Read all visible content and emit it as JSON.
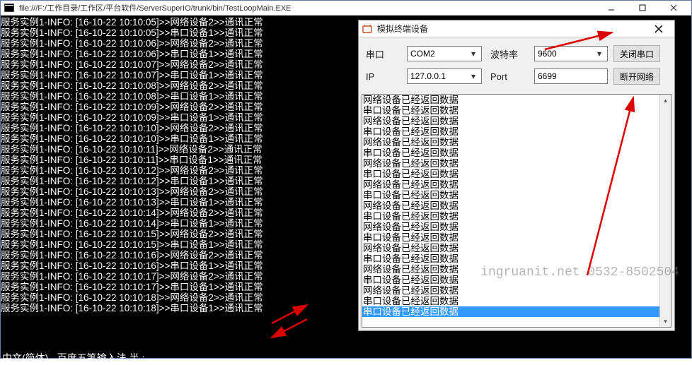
{
  "main_window": {
    "title": "file:///F:/工作目录/工作区/平台软件/ServerSuperIO/trunk/bin/TestLoopMain.EXE"
  },
  "console_lines": [
    "服务实例1-INFO: [16-10-22 10:10:05]>>网络设备2>>通讯正常",
    "服务实例1-INFO: [16-10-22 10:10:05]>>串口设备1>>通讯正常",
    "服务实例1-INFO: [16-10-22 10:10:06]>>网络设备2>>通讯正常",
    "服务实例1-INFO: [16-10-22 10:10:06]>>串口设备1>>通讯正常",
    "服务实例1-INFO: [16-10-22 10:10:07]>>网络设备2>>通讯正常",
    "服务实例1-INFO: [16-10-22 10:10:07]>>串口设备1>>通讯正常",
    "服务实例1-INFO: [16-10-22 10:10:08]>>网络设备2>>通讯正常",
    "服务实例1-INFO: [16-10-22 10:10:08]>>串口设备1>>通讯正常",
    "服务实例1-INFO: [16-10-22 10:10:09]>>网络设备2>>通讯正常",
    "服务实例1-INFO: [16-10-22 10:10:09]>>串口设备1>>通讯正常",
    "服务实例1-INFO: [16-10-22 10:10:10]>>网络设备2>>通讯正常",
    "服务实例1-INFO: [16-10-22 10:10:10]>>串口设备1>>通讯正常",
    "服务实例1-INFO: [16-10-22 10:10:11]>>网络设备2>>通讯正常",
    "服务实例1-INFO: [16-10-22 10:10:11]>>串口设备1>>通讯正常",
    "服务实例1-INFO: [16-10-22 10:10:12]>>网络设备2>>通讯正常",
    "服务实例1-INFO: [16-10-22 10:10:12]>>串口设备1>>通讯正常",
    "服务实例1-INFO: [16-10-22 10:10:13]>>网络设备2>>通讯正常",
    "服务实例1-INFO: [16-10-22 10:10:13]>>串口设备1>>通讯正常",
    "服务实例1-INFO: [16-10-22 10:10:14]>>网络设备2>>通讯正常",
    "服务实例1-INFO: [16-10-22 10:10:14]>>串口设备1>>通讯正常",
    "服务实例1-INFO: [16-10-22 10:10:15]>>网络设备2>>通讯正常",
    "服务实例1-INFO: [16-10-22 10:10:15]>>串口设备1>>通讯正常",
    "服务实例1-INFO: [16-10-22 10:10:16]>>网络设备2>>通讯正常",
    "服务实例1-INFO: [16-10-22 10:10:16]>>串口设备1>>通讯正常",
    "服务实例1-INFO: [16-10-22 10:10:17]>>网络设备2>>通讯正常",
    "服务实例1-INFO: [16-10-22 10:10:17]>>串口设备1>>通讯正常",
    "服务实例1-INFO: [16-10-22 10:10:18]>>网络设备2>>通讯正常",
    "服务实例1-INFO: [16-10-22 10:10:18]>>串口设备1>>通讯正常"
  ],
  "status_line": "中文(简体) - 百度五笔输入法 半 :",
  "dialog": {
    "title": "模拟终端设备",
    "labels": {
      "serial": "串口",
      "baud": "波特率",
      "ip": "IP",
      "port": "Port"
    },
    "values": {
      "serial": "COM2",
      "baud": "9600",
      "ip": "127.0.0.1",
      "port": "6699"
    },
    "buttons": {
      "close_serial": "关闭串口",
      "disconnect_net": "断开网络"
    },
    "log_lines": [
      "网络设备已经返回数据",
      "串口设备已经返回数据",
      "网络设备已经返回数据",
      "串口设备已经返回数据",
      "网络设备已经返回数据",
      "串口设备已经返回数据",
      "网络设备已经返回数据",
      "串口设备已经返回数据",
      "网络设备已经返回数据",
      "串口设备已经返回数据",
      "网络设备已经返回数据",
      "串口设备已经返回数据",
      "网络设备已经返回数据",
      "串口设备已经返回数据",
      "网络设备已经返回数据",
      "串口设备已经返回数据",
      "网络设备已经返回数据",
      "串口设备已经返回数据",
      "网络设备已经返回数据",
      "串口设备已经返回数据",
      "串口设备已经返回数据"
    ],
    "selected_index": 20
  },
  "watermark": "ingruanit.net 0532-8502504"
}
